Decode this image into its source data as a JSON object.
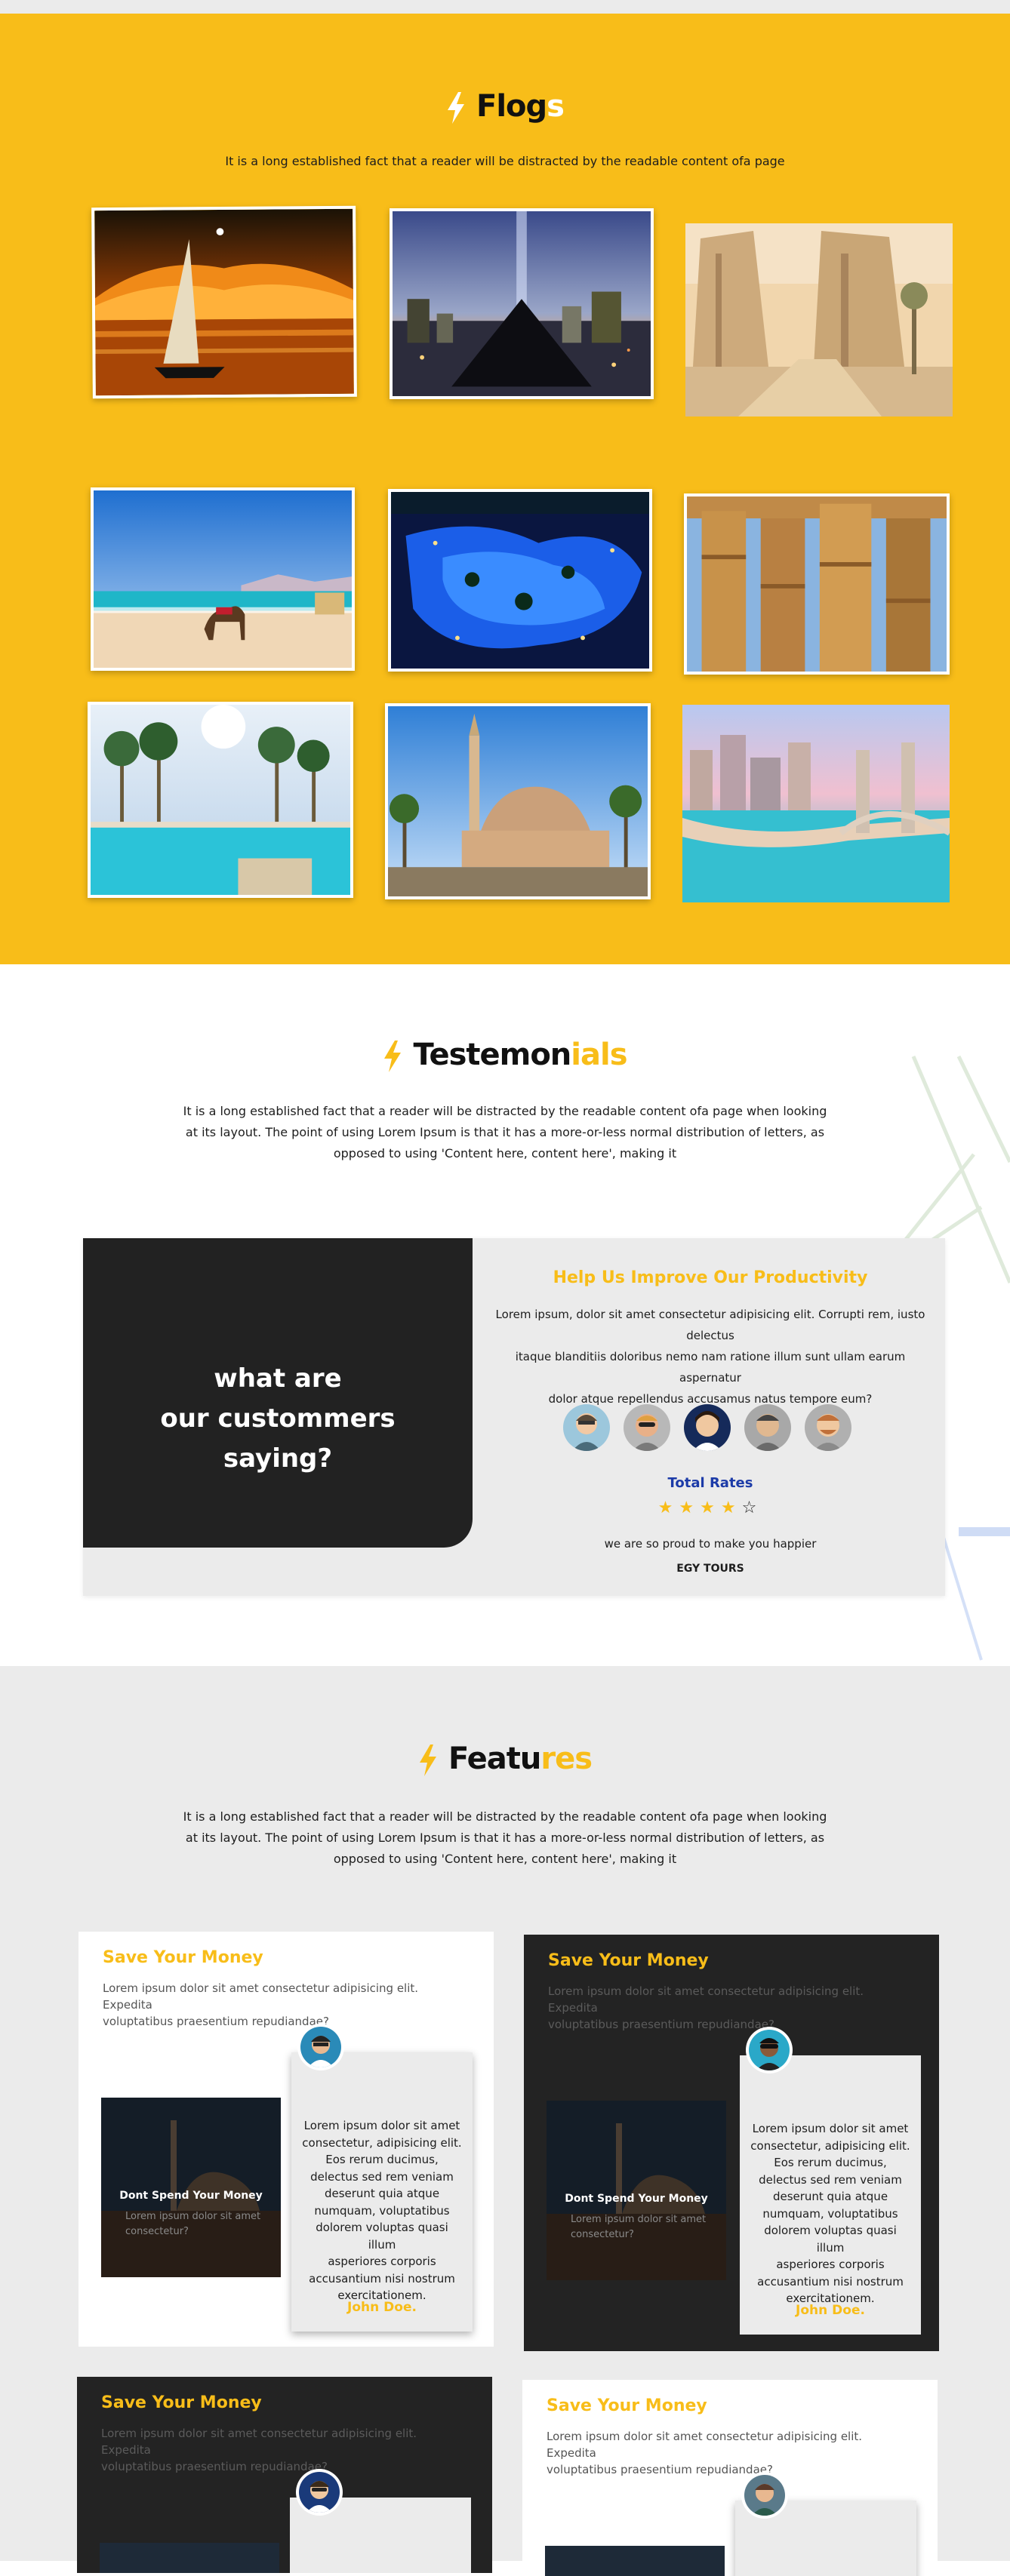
{
  "flogs": {
    "title_main": "Flog",
    "title_accent": "s",
    "subtitle": "It is a long established fact that a reader will be distracted by the readable content ofa page",
    "photos": [
      "nile-night-felucca",
      "las-vegas-pyramid",
      "luxor-temple-entrance",
      "red-sea-beach-camel",
      "resort-pool-night",
      "karnak-columns",
      "resort-pool-palms",
      "sharm-mosque",
      "alexandria-stanley-bridge"
    ]
  },
  "testimonials": {
    "title_main": "Testemon",
    "title_accent": "ials",
    "subtitle_lines": [
      "It is a long established fact that a reader will be distracted by the readable content ofa page when looking",
      "at its layout. The point of using Lorem Ipsum is that it has a more-or-less normal distribution of letters, as",
      "opposed to using 'Content here, content here', making it"
    ],
    "question_lines": [
      "what are",
      "our custommers",
      "saying?"
    ],
    "help_title": "Help Us Improve Our Productivity",
    "help_lines": [
      "Lorem ipsum, dolor sit amet consectetur adipisicing elit. Corrupti rem, iusto delectus",
      "itaque blanditiis doloribus nemo nam ratione illum sunt ullam earum aspernatur",
      "dolor atque repellendus accusamus natus tempore eum?"
    ],
    "total_rates": "Total Rates",
    "rating": 4,
    "rating_max": 5,
    "proud_text": "we are so proud to make you happier",
    "company": "EGY TOURS"
  },
  "features": {
    "title_main": "Featu",
    "title_accent": "res",
    "subtitle_lines": [
      "It is a long established fact that a reader will be distracted by the readable content ofa page when looking",
      "at its layout. The point of using Lorem Ipsum is that it has a more-or-less normal distribution of letters, as",
      "opposed to using 'Content here, content here', making it"
    ],
    "cards": [
      {
        "theme": "light",
        "title": "Save Your Money",
        "desc_lines": [
          "Lorem ipsum dolor sit amet consectetur adipisicing elit. Expedita",
          "voluptatibus praesentium repudiandae?"
        ],
        "img_title": "Dont Spend Your Money",
        "img_text_lines": [
          "Lorem ipsum dolor sit amet",
          "consectetur?"
        ],
        "quote_lines": [
          "Lorem ipsum dolor sit amet",
          "consectetur, adipisicing elit.",
          "Eos rerum ducimus,",
          "delectus sed rem veniam",
          "deserunt quia atque",
          "numquam, voluptatibus",
          "dolorem voluptas quasi illum",
          "asperiores corporis",
          "accusantium nisi nostrum",
          "exercitationem."
        ],
        "author": "John Doe."
      },
      {
        "theme": "dark",
        "title": "Save Your Money",
        "desc_lines": [
          "Lorem ipsum dolor sit amet consectetur adipisicing elit. Expedita",
          "voluptatibus praesentium repudiandae?"
        ],
        "img_title": "Dont Spend Your Money",
        "img_text_lines": [
          "Lorem ipsum dolor sit amet",
          "consectetur?"
        ],
        "quote_lines": [
          "Lorem ipsum dolor sit amet",
          "consectetur, adipisicing elit.",
          "Eos rerum ducimus,",
          "delectus sed rem veniam",
          "deserunt quia atque",
          "numquam, voluptatibus",
          "dolorem voluptas quasi illum",
          "asperiores corporis",
          "accusantium nisi nostrum",
          "exercitationem."
        ],
        "author": "John Doe."
      },
      {
        "theme": "dark",
        "title": "Save Your Money",
        "desc_lines": [
          "Lorem ipsum dolor sit amet consectetur adipisicing elit. Expedita",
          "voluptatibus praesentium repudiandae?"
        ]
      },
      {
        "theme": "light",
        "title": "Save Your Money",
        "desc_lines": [
          "Lorem ipsum dolor sit amet consectetur adipisicing elit. Expedita",
          "voluptatibus praesentium repudiandae?"
        ]
      }
    ]
  },
  "colors": {
    "accent": "#f8bd19",
    "dark": "#222222",
    "light_bg": "#ebebeb",
    "rates_blue": "#1c3ba8"
  }
}
